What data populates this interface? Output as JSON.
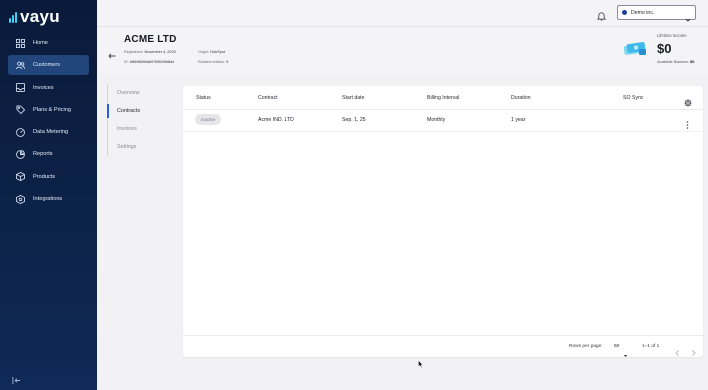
{
  "app": {
    "logo_text": "vayu"
  },
  "sidebar": {
    "items": [
      {
        "label": "Home",
        "icon": "grid-icon",
        "active": false
      },
      {
        "label": "Customers",
        "icon": "users-icon",
        "active": true
      },
      {
        "label": "Invoices",
        "icon": "inbox-icon",
        "active": false
      },
      {
        "label": "Plans & Pricing",
        "icon": "pricing-icon",
        "active": false
      },
      {
        "label": "Data Metering",
        "icon": "gauge-icon",
        "active": false
      },
      {
        "label": "Reports",
        "icon": "reports-icon",
        "active": false
      },
      {
        "label": "Products",
        "icon": "products-icon",
        "active": false
      },
      {
        "label": "Integrations",
        "icon": "integrations-icon",
        "active": false
      }
    ],
    "accent": "#22457c",
    "background": "#0a1a3a"
  },
  "topbar": {
    "org_name": "Demo inc."
  },
  "customer": {
    "name": "ACME LTD",
    "registered_label": "Registered:",
    "registered_value": "November 4, 2025",
    "origin_label": "Origin:",
    "origin_value": "HubSpot",
    "id_label": "ID:",
    "id_value": "6869f68fddb97f65f49b8d4",
    "related_label": "Related entities:",
    "related_value": "9",
    "lifetime_label": "Lifetime Income",
    "lifetime_value": "$0",
    "balance_label": "Available Balance:",
    "balance_value": "$0"
  },
  "subnav": {
    "items": [
      {
        "label": "Overview",
        "active": false
      },
      {
        "label": "Contracts",
        "active": true
      },
      {
        "label": "Invoices",
        "active": false
      },
      {
        "label": "Settings",
        "active": false
      }
    ]
  },
  "table": {
    "columns": [
      "Status",
      "Contract",
      "Start date",
      "Billing Interval",
      "Duration",
      "SO Sync"
    ],
    "rows": [
      {
        "status": "Inactive",
        "contract": "Acme IND. LTD",
        "start_date": "Sep. 1, 25",
        "billing_interval": "Monthly",
        "duration": "1 year",
        "so_sync": ""
      }
    ],
    "footer": {
      "rows_per_page_label": "Rows per page:",
      "rows_per_page_value": "50",
      "range": "1–1 of 1"
    }
  }
}
